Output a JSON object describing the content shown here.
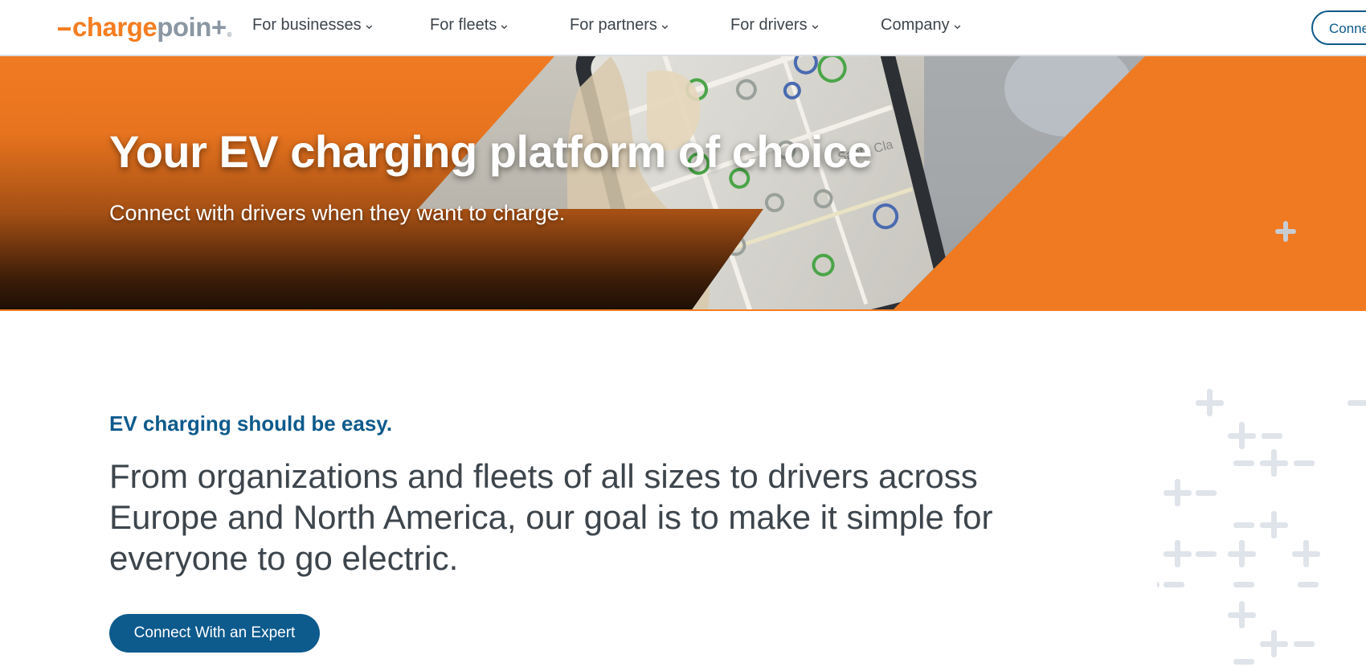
{
  "brand": {
    "logo_charge": "charge",
    "logo_point": "poin",
    "logo_plus": "+",
    "logo_reg": "®",
    "colors": {
      "orange": "#f57d21",
      "blue": "#0d5a8c",
      "grey": "#8a97a3"
    }
  },
  "nav": {
    "items": [
      {
        "label": "For businesses"
      },
      {
        "label": "For fleets"
      },
      {
        "label": "For partners"
      },
      {
        "label": "For drivers"
      },
      {
        "label": "Company"
      }
    ],
    "connect_label": "Conne"
  },
  "hero": {
    "title": "Your EV charging platform of choice",
    "subtitle": "Connect with drivers when they want to charge.",
    "map_label": "Santa Cla"
  },
  "intro": {
    "eyebrow": "EV charging should be easy.",
    "lead": "From organizations and fleets of all sizes to drivers across Europe and North America, our goal is to make it simple for everyone to go electric.",
    "cta_label": "Connect With an Expert"
  }
}
